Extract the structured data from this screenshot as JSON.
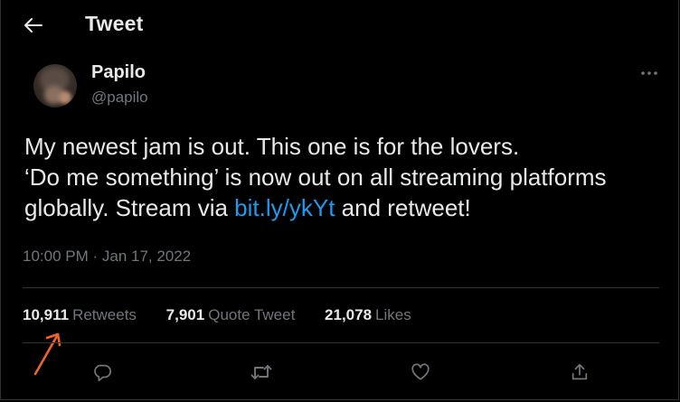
{
  "header": {
    "title": "Tweet",
    "back_icon": "arrow-left-icon"
  },
  "author": {
    "display_name": "Papilo",
    "handle": "@papilo"
  },
  "tweet": {
    "line1": "My newest jam is out. This one is for the lovers.",
    "line2": "‘Do me something’ is now out on all streaming platforms",
    "line3_prefix": "globally. Stream via ",
    "link_text": "bit.ly/ykYt",
    "line3_suffix": " and retweet!",
    "timestamp": "10:00 PM · Jan 17, 2022"
  },
  "stats": {
    "retweets_count": "10,911",
    "retweets_label": "Retweets",
    "quotes_count": "7,901",
    "quotes_label": "Quote Tweet",
    "likes_count": "21,078",
    "likes_label": "Likes"
  },
  "actions": [
    {
      "icon": "reply-icon"
    },
    {
      "icon": "retweet-icon"
    },
    {
      "icon": "heart-icon"
    },
    {
      "icon": "share-icon"
    }
  ],
  "colors": {
    "background": "#000000",
    "primary_text": "#e7e9ea",
    "secondary_text": "#71767b",
    "link": "#1d9bf0",
    "divider": "#2f3336",
    "annotation_arrow": "#f0622a"
  }
}
